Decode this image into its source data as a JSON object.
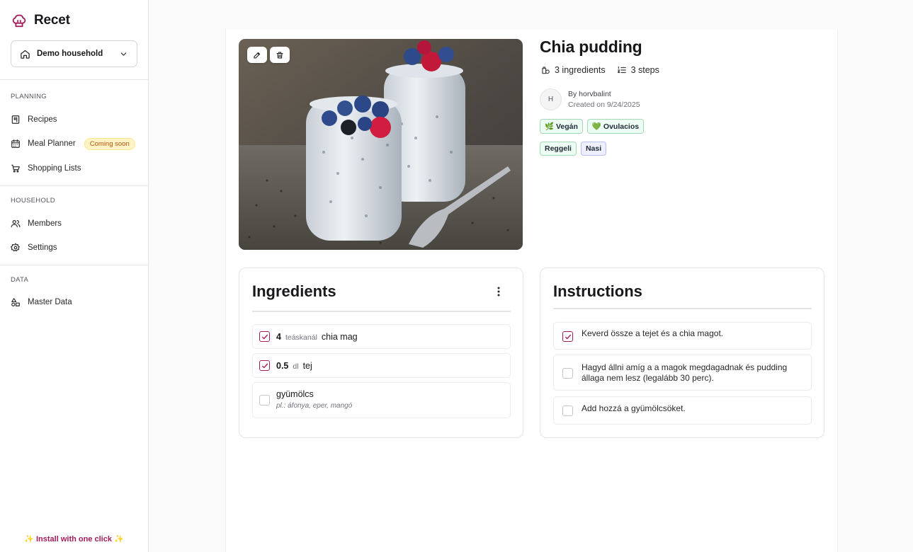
{
  "app": {
    "name": "Recet",
    "accent": "#a21c5b"
  },
  "sidebar": {
    "household": {
      "label": "Demo household"
    },
    "sections": {
      "planning": "PLANNING",
      "household": "HOUSEHOLD",
      "data": "DATA"
    },
    "items": {
      "recipes": {
        "label": "Recipes",
        "icon": "recipe-book-icon"
      },
      "meal_planner": {
        "label": "Meal Planner",
        "icon": "calendar-icon",
        "badge": "Coming soon"
      },
      "shopping_lists": {
        "label": "Shopping Lists",
        "icon": "cart-icon"
      },
      "members": {
        "label": "Members",
        "icon": "users-icon"
      },
      "settings": {
        "label": "Settings",
        "icon": "gear-icon"
      },
      "master_data": {
        "label": "Master Data",
        "icon": "shapes-icon"
      }
    },
    "install": "✨ Install with one click ✨"
  },
  "recipe": {
    "title": "Chia pudding",
    "ingredients_count": "3 ingredients",
    "steps_count": "3 steps",
    "author": "By horvbalint",
    "created": "Created on 9/24/2025",
    "avatar_initial": "H",
    "diet_tags": [
      "🌿 Vegán",
      "💚 Ovulacios"
    ],
    "meal_tags": [
      "Reggeli",
      "Nasi"
    ]
  },
  "ingredients": {
    "title": "Ingredients",
    "items": [
      {
        "qty": "4",
        "unit": "teáskanál",
        "name": "chia mag",
        "note": "",
        "checked": true
      },
      {
        "qty": "0.5",
        "unit": "dl",
        "name": "tej",
        "note": "",
        "checked": true
      },
      {
        "qty": "",
        "unit": "",
        "name": "gyümölcs",
        "note": "pl.: áfonya, eper, mangó",
        "checked": false
      }
    ]
  },
  "instructions": {
    "title": "Instructions",
    "steps": [
      {
        "text": "Keverd össze a tejet és a chia magot.",
        "checked": true
      },
      {
        "text": "Hagyd állni amíg a a magok megdagadnak és pudding állaga nem lesz (legalább 30 perc).",
        "checked": false
      },
      {
        "text": "Add hozzá a gyümölcsöket.",
        "checked": false
      }
    ]
  }
}
